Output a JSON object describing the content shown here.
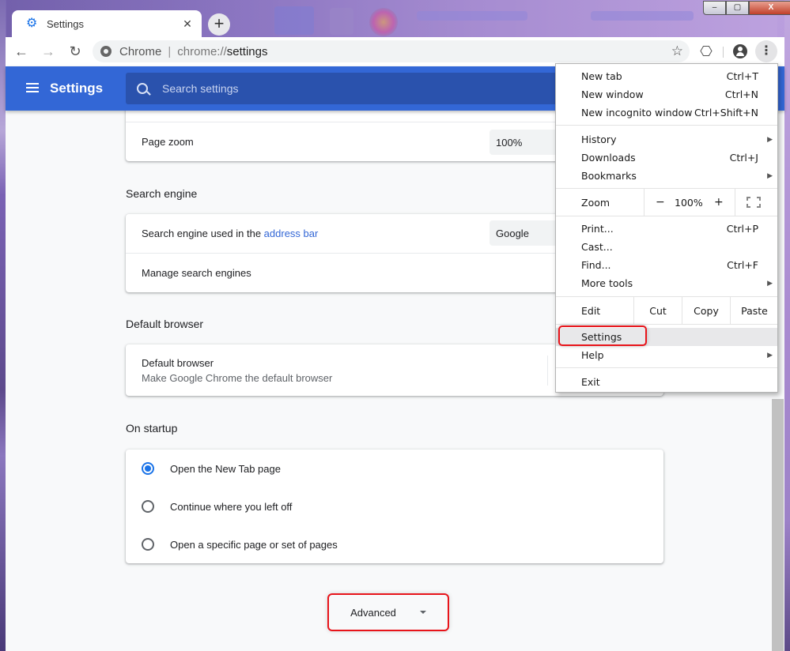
{
  "browser": {
    "tab": {
      "title": "Settings",
      "icon": "gear-icon"
    },
    "window_controls": {
      "minimize": "‒",
      "maximize": "▢",
      "close": "X"
    },
    "toolbar": {
      "omnibox_chip": "Chrome",
      "url_scheme": "chrome://",
      "url_path": "settings"
    }
  },
  "settings_header": {
    "title": "Settings",
    "search_placeholder": "Search settings"
  },
  "sections": {
    "appearance": {
      "page_zoom_label": "Page zoom",
      "page_zoom_value": "100%"
    },
    "search_engine": {
      "title": "Search engine",
      "used_in_prefix": "Search engine used in the ",
      "used_in_link": "address bar",
      "selected_engine": "Google",
      "manage_label": "Manage search engines"
    },
    "default_browser": {
      "title": "Default browser",
      "row_title": "Default browser",
      "row_subtitle": "Make Google Chrome the default browser"
    },
    "on_startup": {
      "title": "On startup",
      "options": [
        {
          "label": "Open the New Tab page",
          "checked": true
        },
        {
          "label": "Continue where you left off",
          "checked": false
        },
        {
          "label": "Open a specific page or set of pages",
          "checked": false
        }
      ]
    }
  },
  "advanced_button": {
    "label": "Advanced"
  },
  "chrome_menu": {
    "items": [
      {
        "label": "New tab",
        "shortcut": "Ctrl+T"
      },
      {
        "label": "New window",
        "shortcut": "Ctrl+N"
      },
      {
        "label": "New incognito window",
        "shortcut": "Ctrl+Shift+N"
      },
      {
        "label": "History",
        "shortcut": ""
      },
      {
        "label": "Downloads",
        "shortcut": "Ctrl+J"
      },
      {
        "label": "Bookmarks",
        "shortcut": ""
      },
      {
        "label": "Print...",
        "shortcut": "Ctrl+P"
      },
      {
        "label": "Cast...",
        "shortcut": ""
      },
      {
        "label": "Find...",
        "shortcut": "Ctrl+F"
      },
      {
        "label": "More tools",
        "shortcut": ""
      },
      {
        "label": "Settings",
        "shortcut": ""
      },
      {
        "label": "Help",
        "shortcut": ""
      },
      {
        "label": "Exit",
        "shortcut": ""
      }
    ],
    "zoom": {
      "label": "Zoom",
      "minus": "−",
      "value": "100%",
      "plus": "+"
    },
    "edit": {
      "label": "Edit",
      "cut": "Cut",
      "copy": "Copy",
      "paste": "Paste"
    }
  }
}
